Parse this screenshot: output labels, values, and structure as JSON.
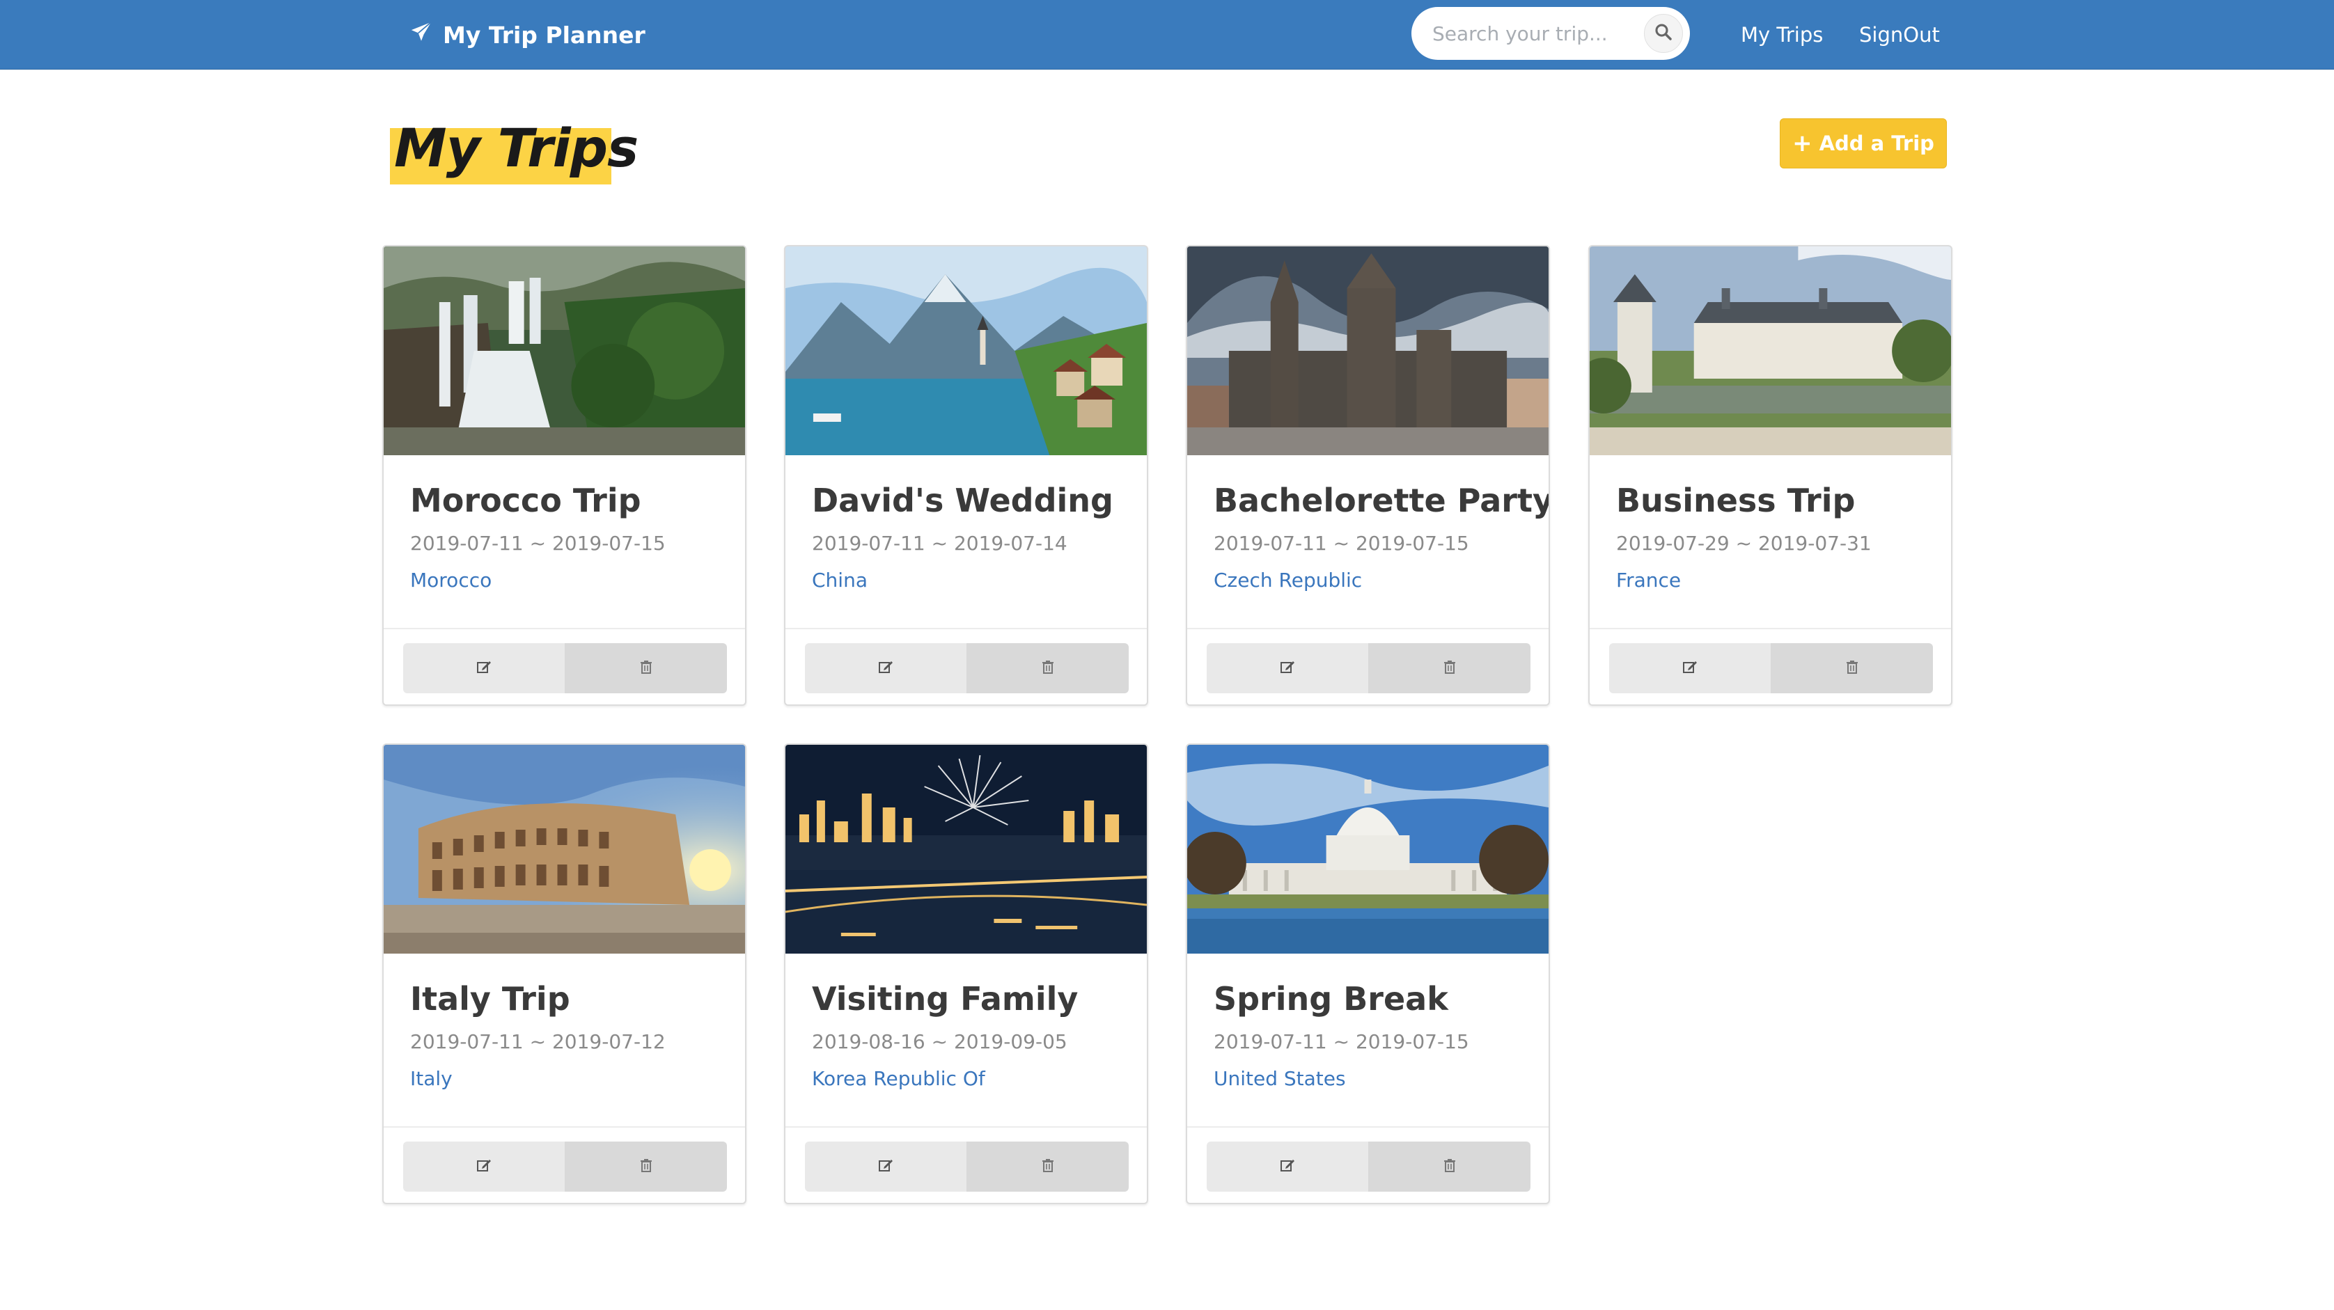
{
  "navbar": {
    "brand": "My Trip Planner",
    "brand_icon": "paper-plane-icon",
    "search_placeholder": "Search your trip...",
    "links": {
      "my_trips": "My Trips",
      "sign_out": "SignOut"
    }
  },
  "header": {
    "title": "My Trips",
    "add_button": "Add a Trip"
  },
  "colors": {
    "navbar": "#3a7bbd",
    "accent_yellow": "#fcd345",
    "button_yellow": "#f7c42f",
    "link_blue": "#3a76bd"
  },
  "trips": [
    {
      "title": "Morocco Trip",
      "dates": "2019-07-11 ~ 2019-07-15",
      "location": "Morocco",
      "image": "waterfall"
    },
    {
      "title": "David's Wedding",
      "dates": "2019-07-11 ~ 2019-07-14",
      "location": "China",
      "image": "lake-village"
    },
    {
      "title": "Bachelorette Party",
      "dates": "2019-07-11 ~ 2019-07-15",
      "location": "Czech Republic",
      "image": "cathedral"
    },
    {
      "title": "Business Trip",
      "dates": "2019-07-29 ~ 2019-07-31",
      "location": "France",
      "image": "chateau"
    },
    {
      "title": "Italy Trip",
      "dates": "2019-07-11 ~ 2019-07-12",
      "location": "Italy",
      "image": "colosseum"
    },
    {
      "title": "Visiting Family",
      "dates": "2019-08-16 ~ 2019-09-05",
      "location": "Korea Republic Of",
      "image": "city-fireworks"
    },
    {
      "title": "Spring Break",
      "dates": "2019-07-11 ~ 2019-07-15",
      "location": "United States",
      "image": "capitol"
    }
  ]
}
